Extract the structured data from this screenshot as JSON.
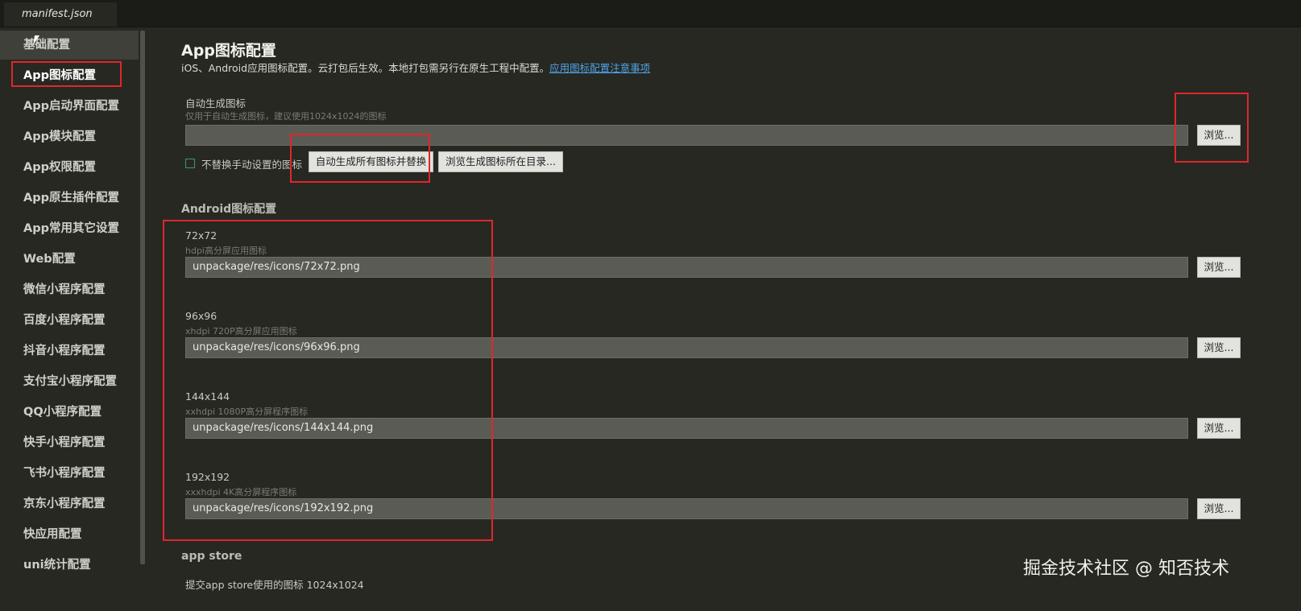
{
  "tab": {
    "title": "manifest.json"
  },
  "sidebar": {
    "items": [
      {
        "label": "基础配置"
      },
      {
        "label": "App图标配置"
      },
      {
        "label": "App启动界面配置"
      },
      {
        "label": "App模块配置"
      },
      {
        "label": "App权限配置"
      },
      {
        "label": "App原生插件配置"
      },
      {
        "label": "App常用其它设置"
      },
      {
        "label": "Web配置"
      },
      {
        "label": "微信小程序配置"
      },
      {
        "label": "百度小程序配置"
      },
      {
        "label": "抖音小程序配置"
      },
      {
        "label": "支付宝小程序配置"
      },
      {
        "label": "QQ小程序配置"
      },
      {
        "label": "快手小程序配置"
      },
      {
        "label": "飞书小程序配置"
      },
      {
        "label": "京东小程序配置"
      },
      {
        "label": "快应用配置"
      },
      {
        "label": "uni统计配置"
      }
    ]
  },
  "main": {
    "title": "App图标配置",
    "description": "iOS、Android应用图标配置。云打包后生效。本地打包需另行在原生工程中配置。",
    "link": "应用图标配置注意事项",
    "auto": {
      "label": "自动生成图标",
      "hint": "仅用于自动生成图标，建议使用1024x1024的图标",
      "value": "",
      "browse": "浏览...",
      "checkbox_label": "不替换手动设置的图标",
      "generate_button": "自动生成所有图标并替换",
      "open_dir_button": "浏览生成图标所在目录..."
    },
    "android": {
      "title": "Android图标配置",
      "icons": [
        {
          "size": "72x72",
          "desc": "hdpi高分屏应用图标",
          "path": "unpackage/res/icons/72x72.png",
          "browse": "浏览..."
        },
        {
          "size": "96x96",
          "desc": "xhdpi 720P高分屏应用图标",
          "path": "unpackage/res/icons/96x96.png",
          "browse": "浏览..."
        },
        {
          "size": "144x144",
          "desc": "xxhdpi 1080P高分屏程序图标",
          "path": "unpackage/res/icons/144x144.png",
          "browse": "浏览..."
        },
        {
          "size": "192x192",
          "desc": "xxxhdpi 4K高分屏程序图标",
          "path": "unpackage/res/icons/192x192.png",
          "browse": "浏览..."
        }
      ]
    },
    "appstore": {
      "title": "app store",
      "hint": "提交app store使用的图标 1024x1024"
    }
  },
  "watermark": "掘金技术社区 @ 知否技术",
  "colors": {
    "background": "#272822",
    "highlight": "#e0262b",
    "link": "#4ea3e8",
    "checkbox": "#3e9a5a"
  }
}
